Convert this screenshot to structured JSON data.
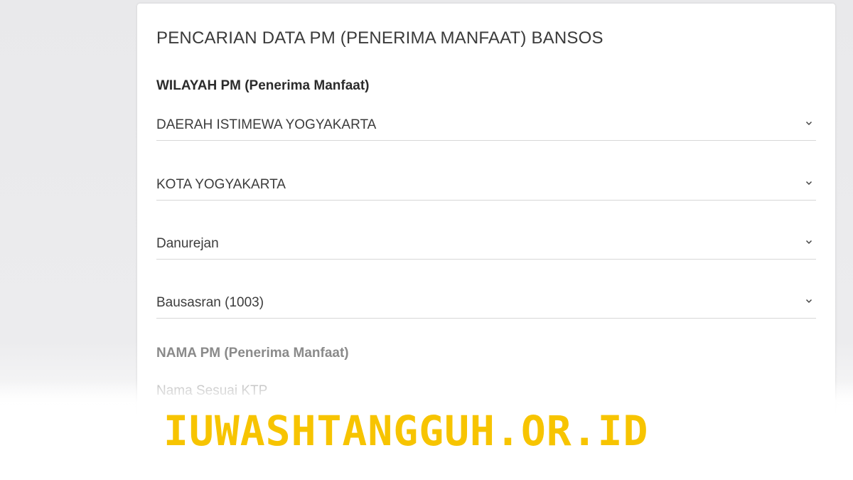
{
  "form": {
    "title": "PENCARIAN DATA PM (PENERIMA MANFAAT) BANSOS",
    "region_label": "WILAYAH PM (Penerima Manfaat)",
    "province": "DAERAH ISTIMEWA YOGYAKARTA",
    "city": "KOTA YOGYAKARTA",
    "district": "Danurejan",
    "village": "Bausasran (1003)",
    "name_label": "NAMA PM (Penerima Manfaat)",
    "name_placeholder": "Nama Sesuai KTP",
    "name_value": ""
  },
  "watermark": {
    "text": "IUWASHTANGGUH.OR.ID"
  },
  "icons": {
    "dropdown": "chevron-down-icon"
  },
  "colors": {
    "watermark": "#f7c400",
    "card_background": "#ffffff",
    "page_background": "#ebebed"
  }
}
